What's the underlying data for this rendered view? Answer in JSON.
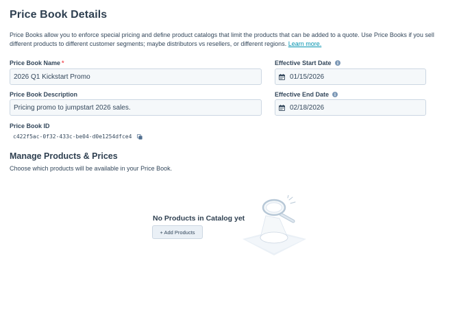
{
  "header": {
    "title": "Price Book Details",
    "description": "Price Books allow you to enforce special pricing and define product catalogs that limit the products that can be added to a quote. Use Price Books if you sell different products to different customer segments; maybe distributors vs resellers, or different regions.",
    "learn_more": "Learn more."
  },
  "form": {
    "name_label": "Price Book Name",
    "required_mark": "*",
    "name_value": "2026 Q1 Kickstart Promo",
    "description_label": "Price Book Description",
    "description_value": "Pricing promo to jumpstart 2026 sales.",
    "id_label": "Price Book ID",
    "id_value": "c422f5ac-0f32-433c-be04-d0e1254dfce4",
    "start_label": "Effective Start Date",
    "start_value": "01/15/2026",
    "end_label": "Effective End Date",
    "end_value": "02/18/2026"
  },
  "products": {
    "title": "Manage Products & Prices",
    "subtitle": "Choose which products will be available in your Price Book.",
    "empty_title": "No Products in Catalog yet",
    "add_button": "+ Add Products"
  },
  "icons": {
    "info": "info-icon",
    "calendar": "calendar-icon",
    "copy": "copy-icon",
    "illustration": "magnifying-glass-spotlight-illustration"
  },
  "colors": {
    "link": "#0091ae",
    "required": "#f2545b",
    "text": "#33475b",
    "heading": "#2e3f50",
    "field_bg": "#f5f8fa",
    "field_border": "#cbd6e2"
  }
}
